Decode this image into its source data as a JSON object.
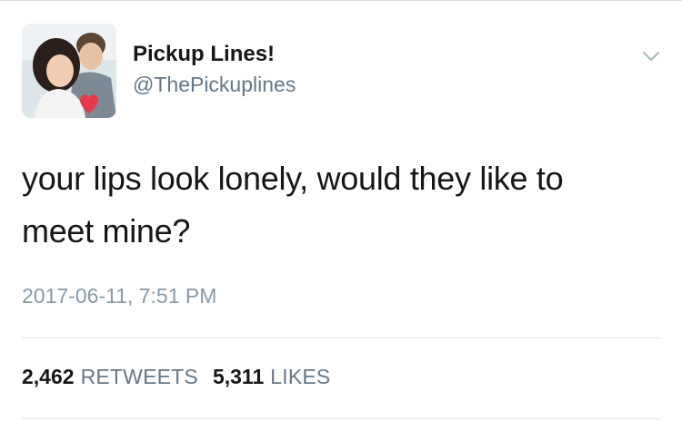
{
  "tweet": {
    "author": {
      "name": "Pickup Lines!",
      "handle": "@ThePickuplines"
    },
    "text_line1": "your lips look lonely, would they like to",
    "text_line2": "meet mine?",
    "timestamp": "2017-06-11, 7:51 PM",
    "stats": {
      "retweets_count": "2,462",
      "retweets_label": "RETWEETS",
      "likes_count": "5,311",
      "likes_label": "LIKES"
    }
  },
  "icons": {
    "menu": "chevron-down-icon"
  },
  "colors": {
    "text_primary": "#14171a",
    "text_secondary": "#657786",
    "timestamp": "#8899a6",
    "divider": "#e1e8ed",
    "heart": "#e8394c"
  }
}
